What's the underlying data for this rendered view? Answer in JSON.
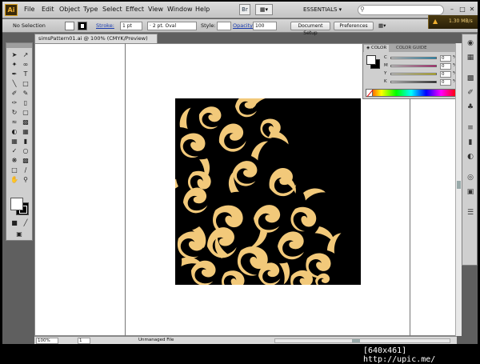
{
  "menubar": {
    "logo": "Ai",
    "items": [
      "File",
      "Edit",
      "Object",
      "Type",
      "Select",
      "Effect",
      "View",
      "Window",
      "Help"
    ],
    "workspace": "ESSENTIALS ▾",
    "search_placeholder": "",
    "window_buttons": [
      "–",
      "□",
      "✕"
    ]
  },
  "control_bar": {
    "selection": "No Selection",
    "stroke_label": "Stroke:",
    "stroke_weight": "1 pt",
    "brush": "2 pt. Oval",
    "style_label": "Style:",
    "opacity_label": "Opacity:",
    "opacity": "100",
    "document_setup": "Document Setup",
    "preferences": "Preferences",
    "speed": "1.30 MB/s"
  },
  "document": {
    "tab_title": "simsPattern01.ai @ 100% (CMYK/Preview)",
    "artwork_bg": "#000000",
    "artwork_fill": "#f2c97a"
  },
  "color_panel": {
    "tab_color": "◈ COLOR",
    "tab_guide": "COLOR GUIDE",
    "channels": [
      {
        "label": "C",
        "value": "0",
        "pct": "%",
        "color": "#00a0e0"
      },
      {
        "label": "M",
        "value": "0",
        "pct": "%",
        "color": "#e0007a"
      },
      {
        "label": "Y",
        "value": "0",
        "pct": "%",
        "color": "#f0e000"
      },
      {
        "label": "K",
        "value": "0",
        "pct": "%",
        "color": "#000000"
      }
    ]
  },
  "status_bar": {
    "zoom": "100%",
    "artboard": "1",
    "status": "Unmanaged File"
  },
  "watermark": "[640x461] http://upic.me/"
}
